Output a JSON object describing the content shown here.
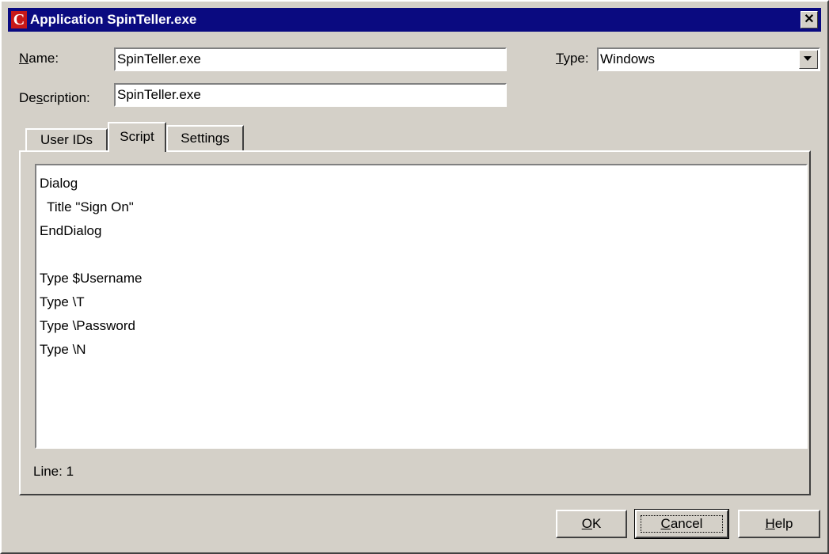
{
  "window": {
    "title": "Application SpinTeller.exe",
    "icon_letter": "C"
  },
  "form": {
    "name_label_prefix": "",
    "name_label_accel": "N",
    "name_label_rest": "ame:",
    "name_value": "SpinTeller.exe",
    "description_label_prefix": "De",
    "description_label_accel": "s",
    "description_label_rest": "cription:",
    "description_value": "SpinTeller.exe",
    "type_label_accel": "T",
    "type_label_rest": "ype:",
    "type_value": "Windows"
  },
  "tabs": [
    {
      "label": "User IDs"
    },
    {
      "label": "Script"
    },
    {
      "label": "Settings"
    }
  ],
  "script": {
    "lines": [
      "Dialog",
      "  Title \"Sign On\"",
      "EndDialog",
      "",
      "Type $Username",
      "Type \\T",
      "Type \\Password",
      "Type \\N"
    ],
    "status": "Line: 1"
  },
  "buttons": {
    "ok_accel": "O",
    "ok_rest": "K",
    "cancel_accel": "C",
    "cancel_rest": "ancel",
    "help_accel": "H",
    "help_rest": "elp"
  },
  "icons": {
    "close": "close-icon",
    "dropdown": "chevron-down-icon",
    "app": "app-icon"
  },
  "colors": {
    "titlebar": "#0a0a80",
    "face": "#d4d0c8",
    "app_icon": "#c81818"
  }
}
